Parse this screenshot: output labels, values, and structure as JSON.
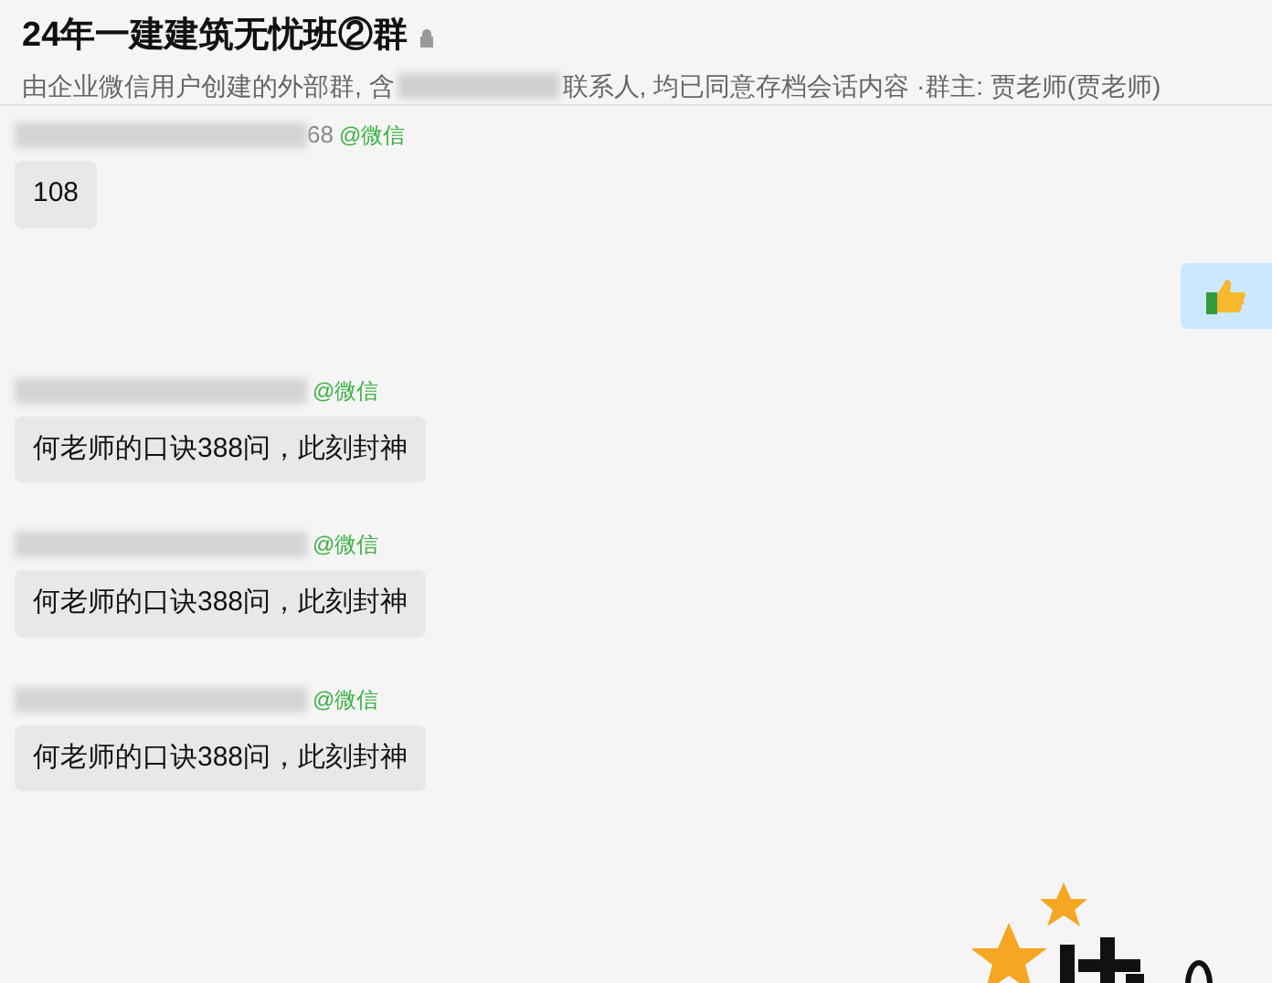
{
  "header": {
    "title": "24年一建建筑无忧班②群",
    "locked": true,
    "subtitle_before": "由企业微信用户创建的外部群, 含",
    "subtitle_after": "联系人, 均已同意存档会话内容 ·群主: 贾老师(贾老师)"
  },
  "messages": [
    {
      "kind": "received",
      "sender_tail": "68",
      "source": "@微信",
      "text": "108"
    },
    {
      "kind": "sent_emoji"
    },
    {
      "kind": "received",
      "source": "@微信",
      "text": "何老师的口诀388问，此刻封神"
    },
    {
      "kind": "received",
      "source": "@微信",
      "text": "何老师的口诀388问，此刻封神"
    },
    {
      "kind": "received",
      "source": "@微信",
      "text": "何老师的口诀388问，此刻封神"
    },
    {
      "kind": "sticker"
    }
  ]
}
